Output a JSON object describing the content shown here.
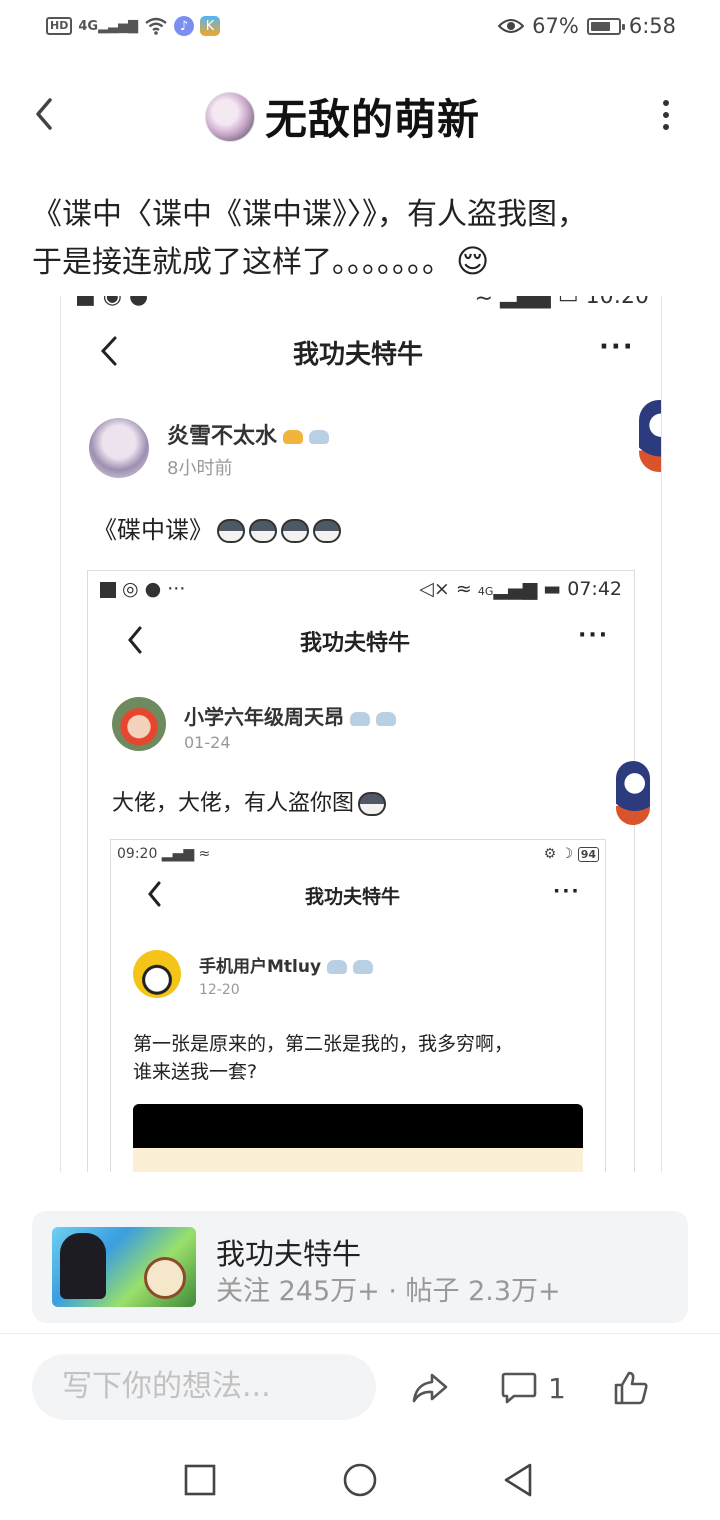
{
  "status_bar": {
    "hd": "HD",
    "network": "4G",
    "battery_text": "67%",
    "battery_level": 0.67,
    "time": "6:58"
  },
  "header": {
    "author_name": "无敌的萌新"
  },
  "post": {
    "text_line1": "《谍中〈谍中《谍中谍》〉》，有人盗我图，",
    "text_line2": "于是接连就成了这样了。。。。。。。",
    "emoji": "😌"
  },
  "screenshot1": {
    "title": "我功夫特牛",
    "more": "···",
    "user_name": "炎雪不太水",
    "time": "8小时前",
    "body": "《碟中谍》"
  },
  "screenshot2": {
    "status_time": "07:42",
    "status_dots": "···",
    "status_network": "4G",
    "title": "我功夫特牛",
    "more": "···",
    "user_name": "小学六年级周天昂",
    "time": "01-24",
    "body": "大佬，大佬，有人盗你图"
  },
  "screenshot3": {
    "status_time": "09:20",
    "battery": "94",
    "title": "我功夫特牛",
    "more": "···",
    "user_name": "手机用户Mtluy",
    "time": "12-20",
    "body_line1": "第一张是原来的，第二张是我的，我多穷啊，",
    "body_line2": "谁来送我一套?"
  },
  "forum_card": {
    "name": "我功夫特牛",
    "stats": "关注 245万+ · 帖子 2.3万+"
  },
  "bottom_bar": {
    "comment_placeholder": "写下你的想法...",
    "comment_count": "1"
  },
  "colors": {
    "card_bg": "#f3f4f6",
    "text_primary": "#222222",
    "text_secondary": "#999999"
  }
}
